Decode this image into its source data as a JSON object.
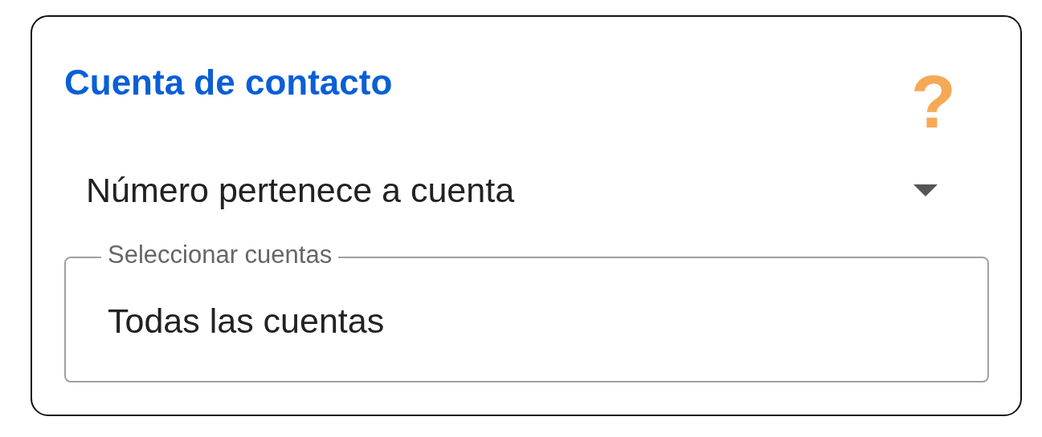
{
  "card": {
    "title": "Cuenta de contacto",
    "help_icon": "?",
    "dropdown": {
      "value": "Número pertenece a cuenta"
    },
    "field": {
      "label": "Seleccionar cuentas",
      "value": "Todas las cuentas"
    }
  }
}
